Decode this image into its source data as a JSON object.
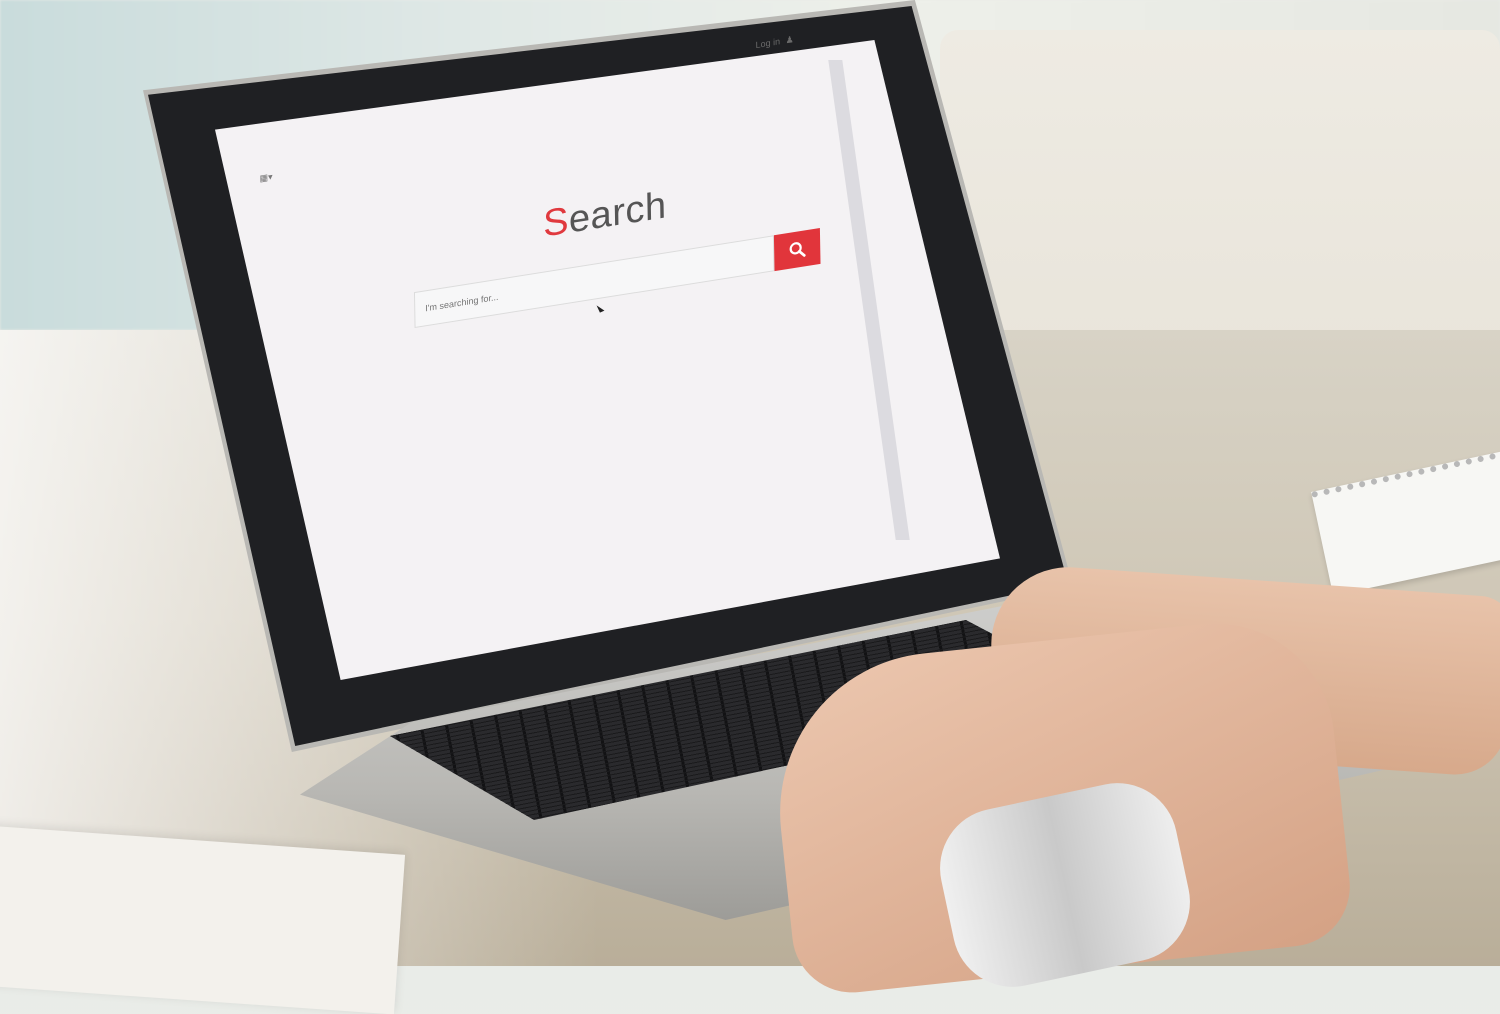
{
  "screen": {
    "login_label": "Log in",
    "login_icon": "user-icon",
    "menu_icon": "grid-menu-icon",
    "title_first_letter": "S",
    "title_rest": "earch",
    "search_placeholder": "I'm searching for...",
    "search_button_icon": "magnifier-icon"
  },
  "colors": {
    "accent": "#e1353b",
    "title_text": "#555555",
    "screen_background": "#f4f2f4"
  }
}
